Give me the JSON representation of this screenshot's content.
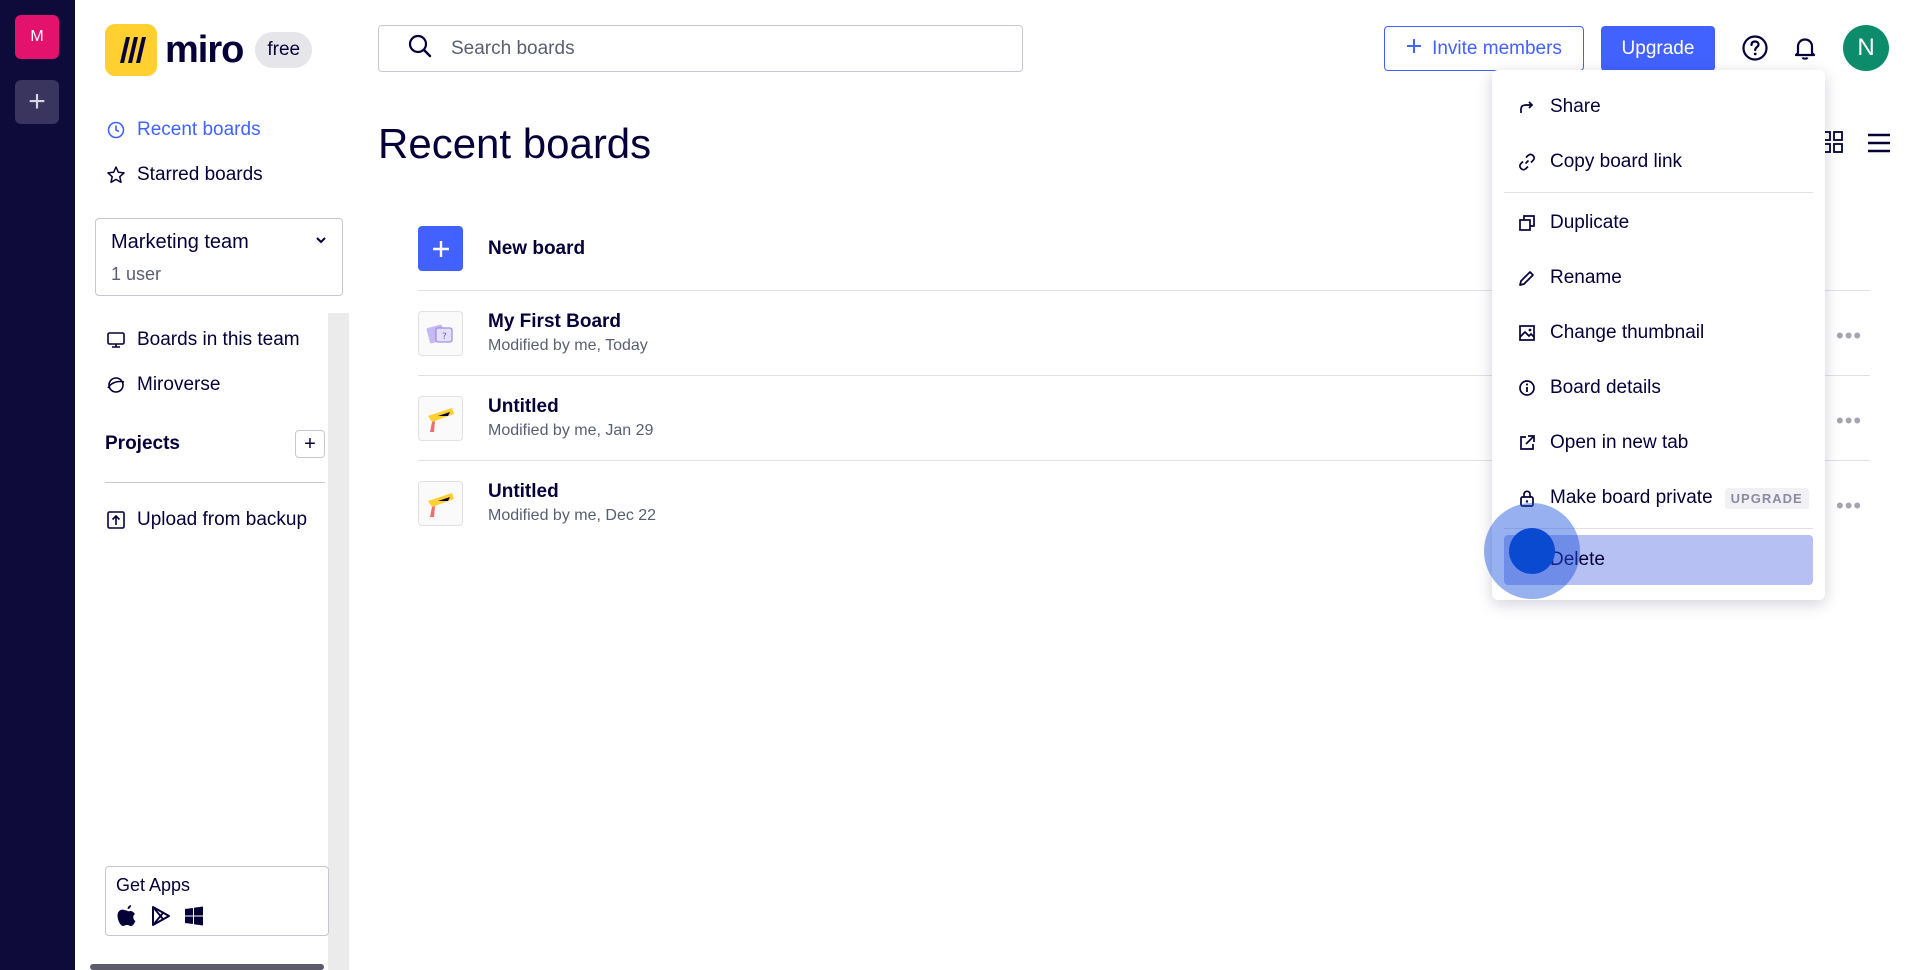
{
  "org": {
    "badge": "M",
    "add_label": "+"
  },
  "sidebar": {
    "logo_text": "miro",
    "plan": "free",
    "nav": [
      {
        "label": "Recent boards",
        "icon": "clock-icon",
        "active": true
      },
      {
        "label": "Starred boards",
        "icon": "star-icon",
        "active": false
      }
    ],
    "team": {
      "name": "Marketing team",
      "users": "1 user"
    },
    "team_nav": [
      {
        "label": "Boards in this team",
        "icon": "boards-icon"
      },
      {
        "label": "Miroverse",
        "icon": "miroverse-icon"
      }
    ],
    "projects_label": "Projects",
    "projects_add": "+",
    "upload_label": "Upload from backup",
    "get_apps_label": "Get Apps"
  },
  "header": {
    "search_placeholder": "Search boards",
    "invite_label": "Invite members",
    "upgrade_label": "Upgrade",
    "avatar_initial": "N"
  },
  "main": {
    "title": "Recent boards",
    "new_board_label": "New board",
    "boards": [
      {
        "name": "My First Board",
        "meta": "Modified by me, Today"
      },
      {
        "name": "Untitled",
        "meta": "Modified by me, Jan 29"
      },
      {
        "name": "Untitled",
        "meta": "Modified by me, Dec 22"
      }
    ]
  },
  "context_menu": {
    "items": [
      {
        "label": "Share",
        "icon": "share-icon"
      },
      {
        "label": "Copy board link",
        "icon": "link-icon"
      },
      {
        "label": "Duplicate",
        "icon": "duplicate-icon"
      },
      {
        "label": "Rename",
        "icon": "pencil-icon"
      },
      {
        "label": "Change thumbnail",
        "icon": "image-icon"
      },
      {
        "label": "Board details",
        "icon": "info-icon"
      },
      {
        "label": "Open in new tab",
        "icon": "external-link-icon"
      },
      {
        "label": "Make board private",
        "icon": "lock-icon",
        "tag": "UPGRADE"
      },
      {
        "label": "Delete",
        "icon": "trash-icon"
      }
    ]
  },
  "colors": {
    "accent": "#4262ff",
    "rail": "#0e0a3a",
    "org_badge": "#e2126d",
    "avatar": "#0c8c6a",
    "logo": "#ffd02f",
    "delete_highlight": "#b6c0f2"
  }
}
